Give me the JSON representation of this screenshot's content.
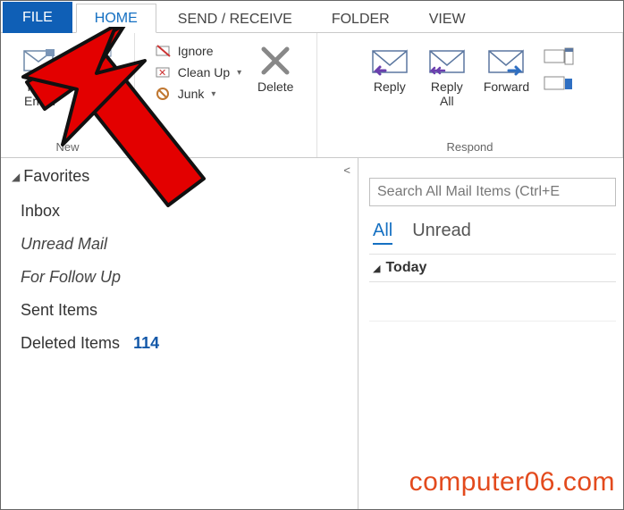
{
  "tabs": {
    "file": "FILE",
    "home": "HOME",
    "send_receive": "SEND / RECEIVE",
    "folder": "FOLDER",
    "view": "VIEW"
  },
  "ribbon": {
    "new": {
      "label": "New",
      "new_email": "New\nEmail",
      "new_items": "Ite"
    },
    "delete_group": {
      "ignore": "Ignore",
      "cleanup": "Clean Up",
      "junk": "Junk",
      "delete": "Delete"
    },
    "respond": {
      "label": "Respond",
      "reply": "Reply",
      "reply_all": "Reply\nAll",
      "forward": "Forward"
    }
  },
  "nav": {
    "favorites": "Favorites",
    "items": [
      {
        "label": "Inbox",
        "italic": false
      },
      {
        "label": "Unread Mail",
        "italic": true
      },
      {
        "label": "For Follow Up",
        "italic": true
      },
      {
        "label": "Sent Items",
        "italic": false
      },
      {
        "label": "Deleted Items",
        "italic": false,
        "count": "114"
      }
    ]
  },
  "mail": {
    "search_placeholder": "Search All Mail Items (Ctrl+E",
    "filter_all": "All",
    "filter_unread": "Unread",
    "group_today": "Today"
  },
  "watermark": "computer06.com"
}
